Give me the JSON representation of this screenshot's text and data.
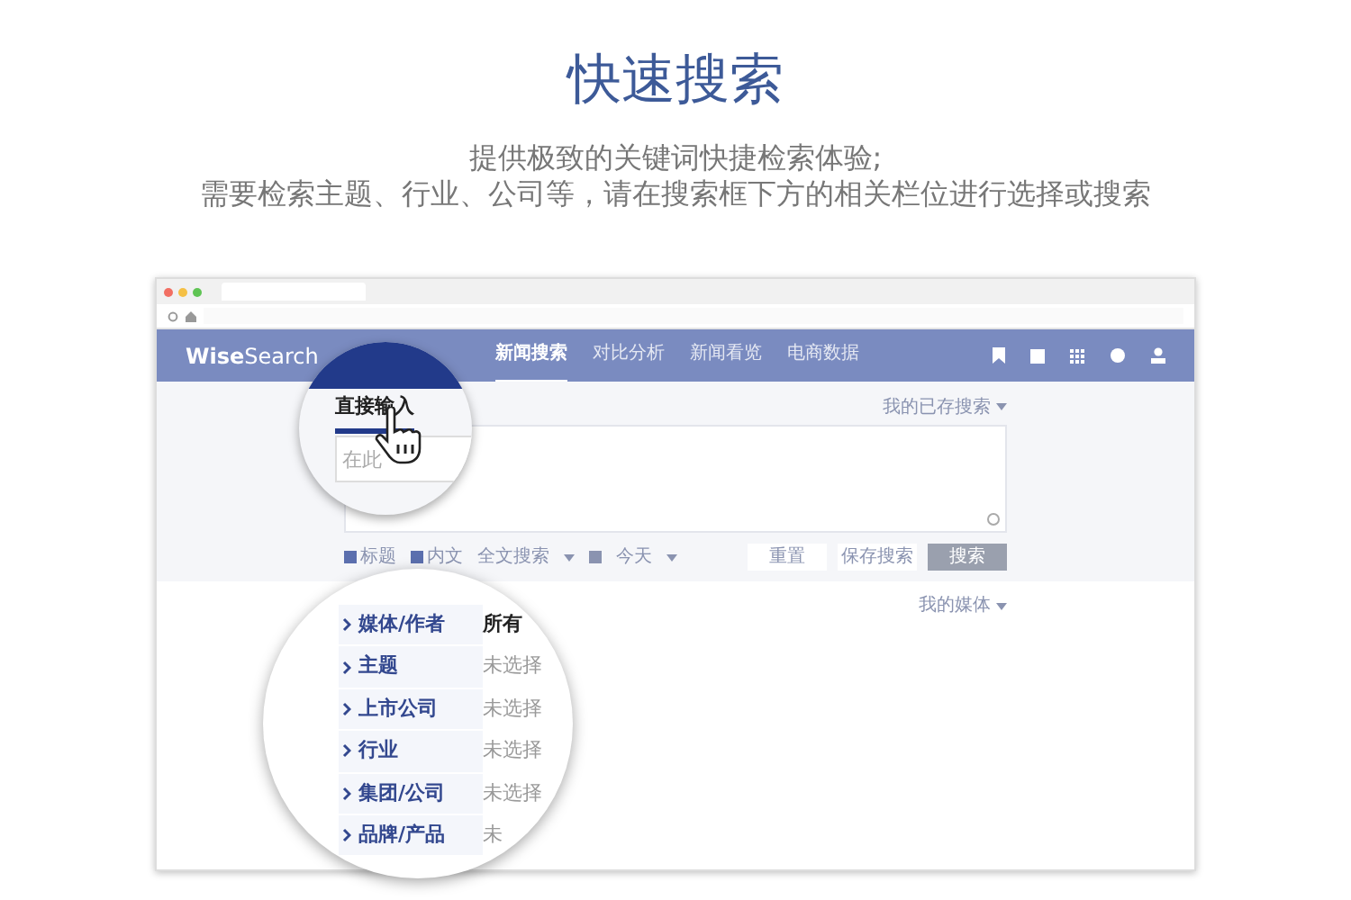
{
  "heading": "快速搜索",
  "intro": [
    "提供极致的关键词快捷检索体验;",
    "需要检索主题、行业、公司等，请在搜索框下方的相关栏位进行选择或搜索"
  ],
  "app": {
    "logo_bold": "Wise",
    "logo_light": "Search",
    "nav": [
      {
        "label": "新闻搜索",
        "selected": true
      },
      {
        "label": "对比分析",
        "selected": false
      },
      {
        "label": "新闻看览",
        "selected": false
      },
      {
        "label": "电商数据",
        "selected": false
      }
    ],
    "saved_searches": "我的已存搜索",
    "options": [
      {
        "label": "标题",
        "checked": true
      },
      {
        "label": "内文",
        "checked": true
      }
    ],
    "mode": "全文搜索",
    "date": "今天",
    "buttons": [
      {
        "label": "重置",
        "kind": "plain"
      },
      {
        "label": "保存搜索",
        "kind": "plain"
      },
      {
        "label": "搜索",
        "kind": "primary"
      }
    ],
    "my_media": "我的媒体"
  },
  "magnifier_top": {
    "tab": {
      "label": "直接输入",
      "selected": true
    },
    "placeholder": "在此"
  },
  "magnifier_bottom": {
    "filters": [
      {
        "label": "媒体/作者",
        "value": "所有",
        "kind": "set"
      },
      {
        "label": "主题",
        "value": "未选择",
        "kind": "unset"
      },
      {
        "label": "上市公司",
        "value": "未选择",
        "kind": "unset"
      },
      {
        "label": "行业",
        "value": "未选择",
        "kind": "unset"
      },
      {
        "label": "集团/公司",
        "value": "未选择",
        "kind": "unset"
      },
      {
        "label": "品牌/产品",
        "value": "未",
        "kind": "unset"
      }
    ]
  }
}
